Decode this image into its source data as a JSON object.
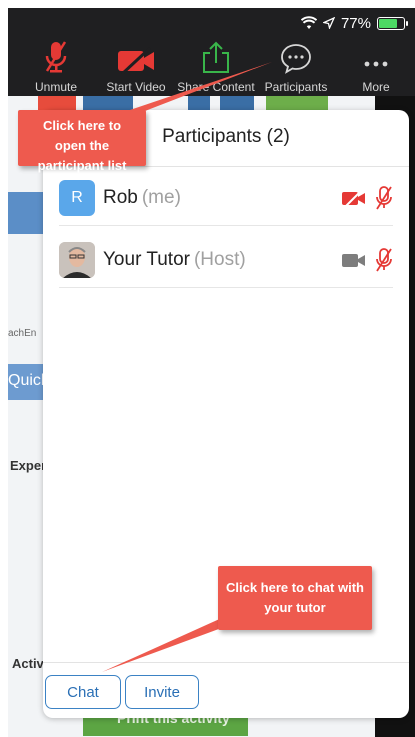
{
  "status": {
    "battery_percent": "77%"
  },
  "toolbar": {
    "unmute": "Unmute",
    "start_video": "Start Video",
    "share_content": "Share Content",
    "participants": "Participants",
    "more": "More"
  },
  "background": {
    "cut_text_1": "achEn",
    "cut_text_2": "Quick",
    "cut_text_3": "Exper",
    "cut_text_4": "Activ",
    "green_button": "Print this activity"
  },
  "panel": {
    "title": "Participants (2)",
    "participants": [
      {
        "initial": "R",
        "name": "Rob",
        "role": "(me)",
        "avatar_color": "#5aa7ea"
      },
      {
        "initial": "",
        "name": "Your Tutor",
        "role": "(Host)"
      }
    ],
    "chat_button": "Chat",
    "invite_button": "Invite"
  },
  "callouts": {
    "participants_tip": "Click here to open the participant list",
    "chat_tip": "Click here to chat with your tutor"
  },
  "colors": {
    "accent": "#ee5a4e",
    "muted_red": "#e74c3c",
    "link_blue": "#2a6fb5"
  }
}
